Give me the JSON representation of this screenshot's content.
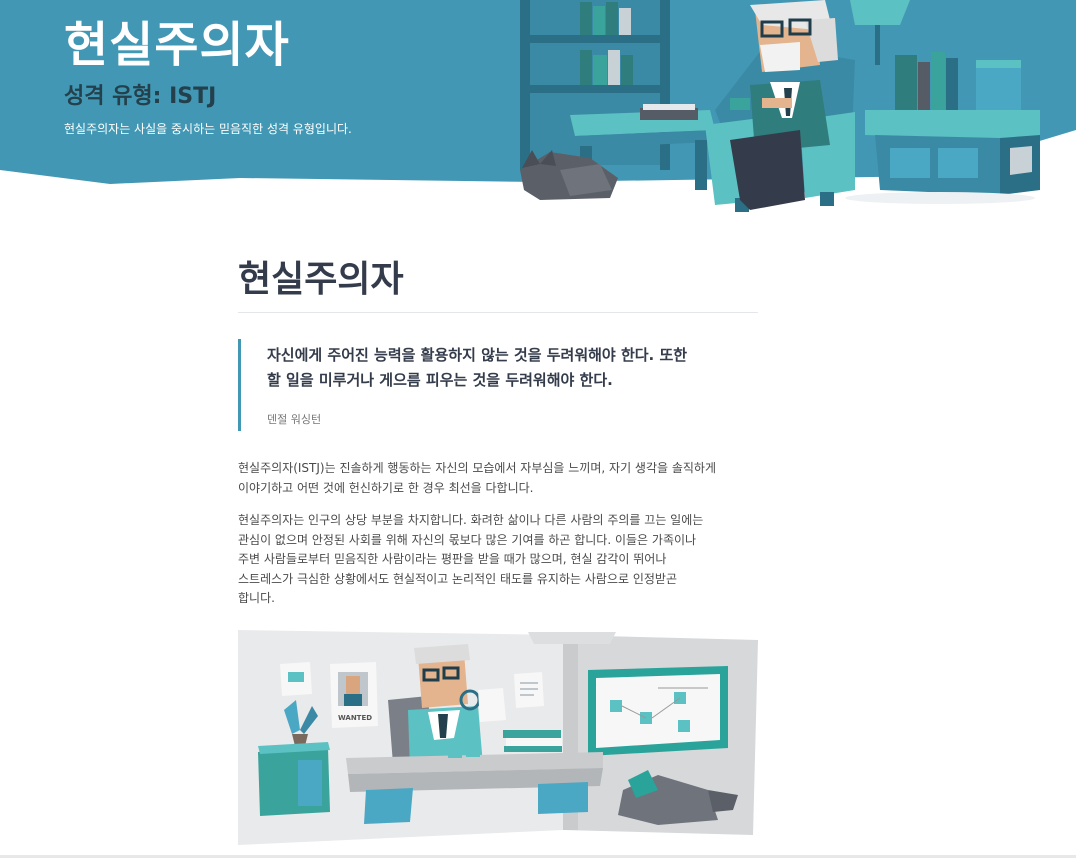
{
  "hero": {
    "title": "현실주의자",
    "subtitle": "성격 유형: ISTJ",
    "description": "현실주의자는 사실을 중시하는 믿음직한 성격 유형입니다.",
    "illustration": "old-man-reading-in-armchair-illustration"
  },
  "section": {
    "title": "현실주의자"
  },
  "quote": {
    "line1": "자신에게 주어진 능력을 활용하지 않는 것을 두려워해야 한다. 또한",
    "line2": "할 일을 미루거나 게으름 피우는 것을 두려워해야 한다.",
    "author": "덴절 워싱턴"
  },
  "paragraph1": {
    "line1": "현실주의자(ISTJ)는 진솔하게 행동하는 자신의 모습에서 자부심을 느끼며, 자기 생각을 솔직하게",
    "line2": "이야기하고 어떤 것에 헌신하기로 한 경우 최선을 다합니다."
  },
  "paragraph2": {
    "line1": "현실주의자는 인구의 상당 부분을 차지합니다. 화려한 삶이나 다른 사람의 주의를 끄는 일에는",
    "line2": "관심이 없으며 안정된 사회를 위해 자신의 몫보다 많은 기여를 하곤 합니다. 이들은 가족이나",
    "line3": "주변 사람들로부터 믿음직한 사람이라는 평판을 받을 때가 많으며, 현실 감각이 뛰어나",
    "line4": "스트레스가 극심한 상황에서도 현실적이고 논리적인 태도를 유지하는 사람으로 인정받곤",
    "line5": "합니다."
  },
  "illustration": {
    "name": "detective-office-illustration",
    "poster_label": "WANTED"
  },
  "colors": {
    "hero_bg": "#4298b4",
    "accent": "#4298b4",
    "title_dark": "#343c4b",
    "subtitle_dark": "#23404c"
  }
}
